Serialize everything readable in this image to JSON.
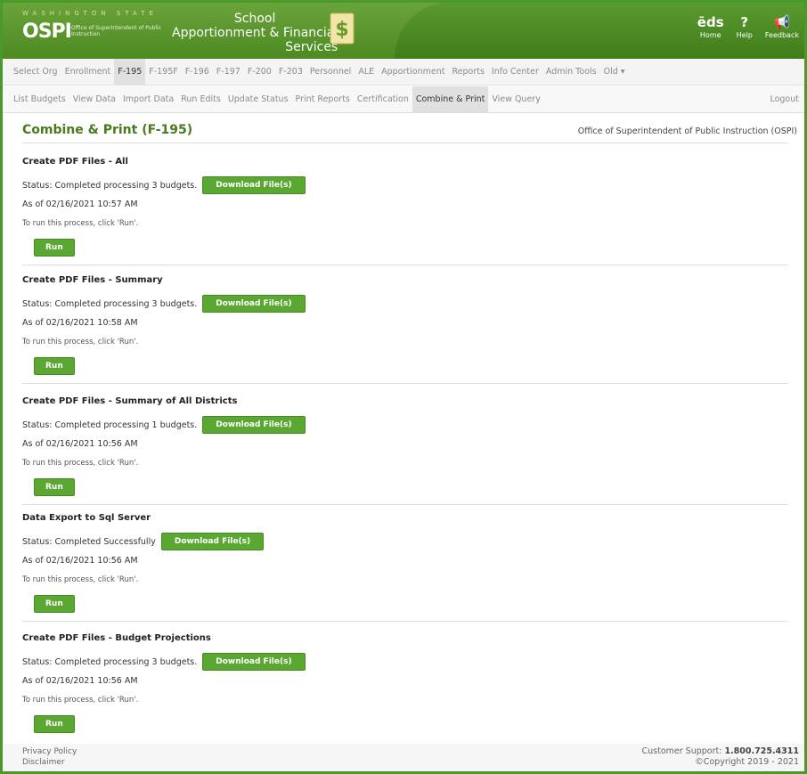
{
  "header": {
    "wa_state": "WASHINGTON STATE",
    "ospi": "OSPI",
    "ospi_sub": "Office of Superintendent of Public Instruction",
    "app_line1": "School",
    "app_line2": "Apportionment & Financial",
    "app_line3": "Services",
    "icons": [
      {
        "name": "home-icon",
        "glyph": "ēds",
        "label": "Home"
      },
      {
        "name": "help-icon",
        "glyph": "?",
        "label": "Help"
      },
      {
        "name": "feedback-icon",
        "glyph": "📢",
        "label": "Feedback"
      }
    ]
  },
  "nav1": [
    "Select Org",
    "Enrollment",
    "F-195",
    "F-195F",
    "F-196",
    "F-197",
    "F-200",
    "F-203",
    "Personnel",
    "ALE",
    "Apportionment",
    "Reports",
    "Info Center",
    "Admin Tools",
    "Old ▾"
  ],
  "nav1_active": "F-195",
  "nav2": [
    "List Budgets",
    "View Data",
    "Import Data",
    "Run Edits",
    "Update Status",
    "Print Reports",
    "Certification",
    "Combine & Print",
    "View Query"
  ],
  "nav2_active": "Combine & Print",
  "logout": "Logout",
  "page": {
    "title": "Combine & Print (F-195)",
    "office": "Office of Superintendent of Public Instruction (OSPI)"
  },
  "sections": [
    {
      "title": "Create PDF Files - All",
      "status": "Status: Completed processing 3 budgets.",
      "download": "Download File(s)",
      "asof": "As of 02/16/2021 10:57 AM",
      "torun": "To run this process, click 'Run'.",
      "run": "Run"
    },
    {
      "title": "Create PDF Files - Summary",
      "status": "Status: Completed processing 3 budgets.",
      "download": "Download File(s)",
      "asof": "As of 02/16/2021 10:58 AM",
      "torun": "To run this process, click 'Run'.",
      "run": "Run"
    },
    {
      "title": "Create PDF Files - Summary of All Districts",
      "status": "Status: Completed processing 1 budgets.",
      "download": "Download File(s)",
      "asof": "As of 02/16/2021 10:56 AM",
      "torun": "To run this process, click 'Run'.",
      "run": "Run"
    },
    {
      "title": "Data Export to Sql Server",
      "status": "Status: Completed Successfully",
      "download": "Download File(s)",
      "asof": "As of 02/16/2021 10:56 AM",
      "torun": "To run this process, click 'Run'.",
      "run": "Run"
    },
    {
      "title": "Create PDF Files - Budget Projections",
      "status": "Status: Completed processing 3 budgets.",
      "download": "Download File(s)",
      "asof": "As of 02/16/2021 10:56 AM",
      "torun": "To run this process, click 'Run'.",
      "run": "Run"
    }
  ],
  "footer": {
    "privacy": "Privacy Policy",
    "disclaimer": "Disclaimer",
    "support_label": "Customer Support:",
    "support_phone": "1.800.725.4311",
    "copyright": "©Copyright 2019 - 2021"
  },
  "colors": {
    "brand_green": "#4d8a22",
    "button_green": "#5aa832",
    "title_green": "#4a7a1e"
  }
}
